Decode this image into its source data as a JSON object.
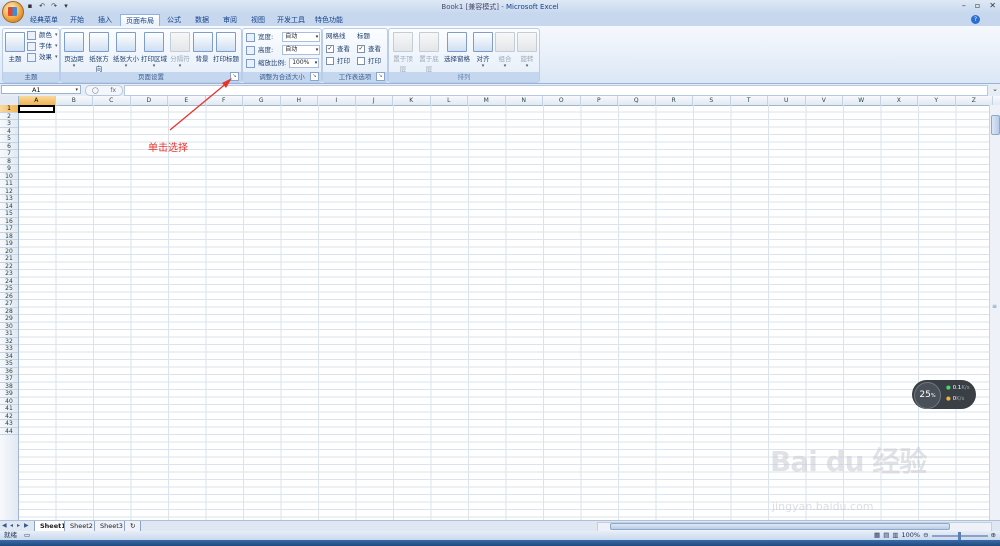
{
  "window": {
    "title": "Book1  [兼容模式] - ",
    "app_name": "Microsoft Excel"
  },
  "tabs": [
    "经典菜单",
    "开始",
    "插入",
    "页面布局",
    "公式",
    "数据",
    "审阅",
    "视图",
    "开发工具",
    "特色功能"
  ],
  "active_tab": "页面布局",
  "ribbon": {
    "theme_group": {
      "label": "主题",
      "big_button": "主题",
      "small": [
        "颜色",
        "字体",
        "效果"
      ]
    },
    "page_setup_group": {
      "label": "页面设置",
      "buttons": [
        "页边距",
        "纸张方向",
        "纸张大小",
        "打印区域",
        "分隔符",
        "背景",
        "打印标题"
      ]
    },
    "scale_group": {
      "label": "调整为合适大小",
      "width_label": "宽度:",
      "width_value": "自动",
      "height_label": "高度:",
      "height_value": "自动",
      "scale_label": "缩放比例:",
      "scale_value": "100%"
    },
    "sheet_options_group": {
      "label": "工作表选项",
      "gridlines_title": "网格线",
      "headings_title": "标题",
      "view": "查看",
      "print": "打印"
    },
    "arrange_group": {
      "label": "排列",
      "buttons": [
        "置于顶层",
        "置于底层",
        "选择窗格",
        "对齐",
        "组合",
        "旋转"
      ]
    }
  },
  "formula_bar": {
    "name_box": "A1",
    "fx": "fx"
  },
  "columns": [
    "A",
    "B",
    "C",
    "D",
    "E",
    "F",
    "G",
    "H",
    "I",
    "J",
    "K",
    "L",
    "M",
    "N",
    "O",
    "P",
    "Q",
    "R",
    "S",
    "T",
    "U",
    "V",
    "W",
    "X",
    "Y",
    "Z"
  ],
  "rows": [
    "1",
    "2",
    "3",
    "4",
    "5",
    "6",
    "7",
    "8",
    "9",
    "10",
    "11",
    "12",
    "13",
    "14",
    "15",
    "16",
    "17",
    "18",
    "19",
    "20",
    "21",
    "22",
    "23",
    "24",
    "25",
    "26",
    "27",
    "28",
    "29",
    "30",
    "31",
    "32",
    "33",
    "34",
    "35",
    "36",
    "37",
    "38",
    "39",
    "40",
    "41",
    "42",
    "43",
    "44"
  ],
  "sheet_tabs": [
    "Sheet1",
    "Sheet2",
    "Sheet3"
  ],
  "status": {
    "ready": "就绪",
    "zoom": "100%"
  },
  "annotation": "单击选择",
  "speed_widget": {
    "percent": "25",
    "percent_unit": "%",
    "up": "0.1",
    "up_unit": "K/s",
    "down": "0",
    "down_unit": "K/s"
  },
  "watermark": {
    "logo": "Bai du 经验",
    "url": "jingyan.baidu.com"
  },
  "colors": {
    "accent": "#15428b",
    "annotation": "#e8322c",
    "selected_header": "#f1b450"
  }
}
